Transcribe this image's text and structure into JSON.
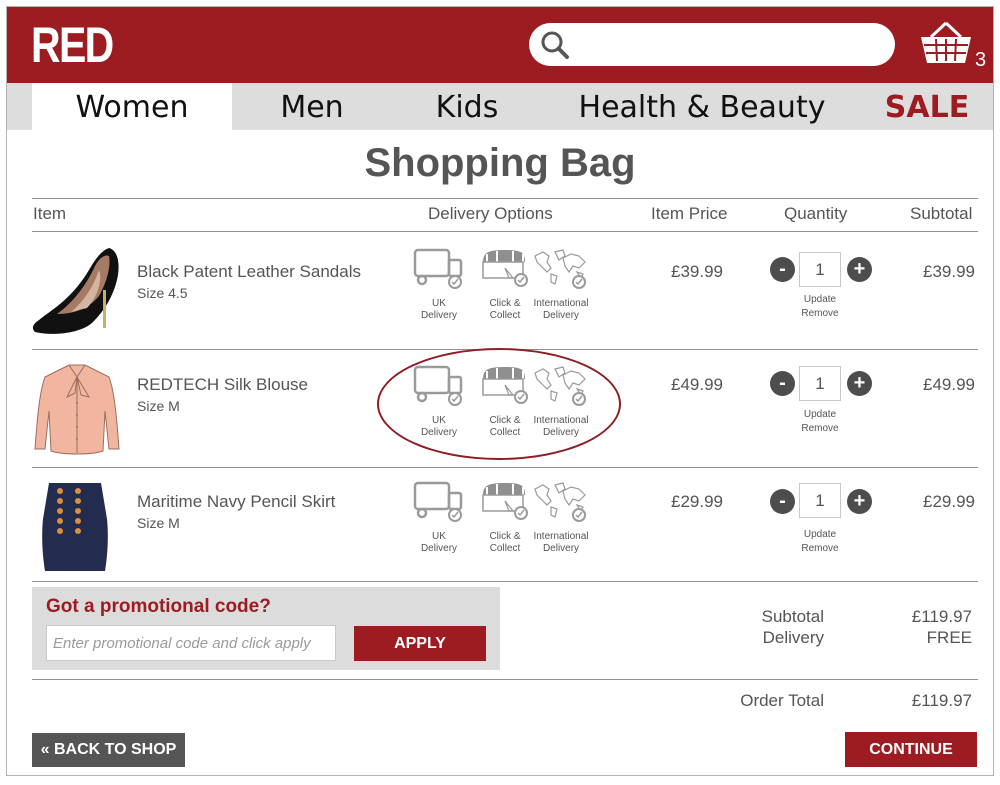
{
  "header": {
    "logo": "RED",
    "search": {
      "placeholder": "",
      "value": "",
      "icon": "search-icon"
    },
    "basket": {
      "icon": "basket-icon",
      "count": "3"
    },
    "brand_color": "#9c1c22"
  },
  "nav": {
    "items": [
      {
        "label": "Women",
        "active": true
      },
      {
        "label": "Men"
      },
      {
        "label": "Kids"
      },
      {
        "label": "Health & Beauty"
      },
      {
        "label": "SALE",
        "highlight": true
      }
    ]
  },
  "page_title": "Shopping Bag",
  "table": {
    "headers": {
      "item": "Item",
      "delivery": "Delivery Options",
      "price": "Item Price",
      "quantity": "Quantity",
      "subtotal": "Subtotal"
    },
    "delivery_options": [
      {
        "line1": "UK",
        "line2": "Delivery",
        "icon": "truck-icon"
      },
      {
        "line1": "Click &",
        "line2": "Collect",
        "icon": "store-icon"
      },
      {
        "line1": "International",
        "line2": "Delivery",
        "icon": "world-map-icon"
      }
    ],
    "rows": [
      {
        "name": "Black Patent Leather Sandals",
        "size": "Size 4.5",
        "image": "black-high-heel-shoe",
        "price": "£39.99",
        "quantity": "1",
        "subtotal": "£39.99",
        "update": "Update",
        "remove": "Remove"
      },
      {
        "name": "REDTECH Silk Blouse",
        "size": "Size M",
        "image": "pink-silk-blouse",
        "price": "£49.99",
        "quantity": "1",
        "subtotal": "£49.99",
        "update": "Update",
        "remove": "Remove",
        "delivery_highlighted": true
      },
      {
        "name": "Maritime Navy Pencil Skirt",
        "size": "Size M",
        "image": "navy-pencil-skirt",
        "price": "£29.99",
        "quantity": "1",
        "subtotal": "£29.99",
        "update": "Update",
        "remove": "Remove"
      }
    ],
    "qty_minus": "-",
    "qty_plus": "+"
  },
  "promo": {
    "title": "Got a promotional code?",
    "placeholder": "Enter promotional code and click apply",
    "value": "",
    "apply_label": "APPLY"
  },
  "summary": {
    "subtotal_label": "Subtotal",
    "subtotal_value": "£119.97",
    "delivery_label": "Delivery",
    "delivery_value": "FREE",
    "total_label": "Order Total",
    "total_value": "£119.97"
  },
  "actions": {
    "back_label": "« BACK TO SHOP",
    "continue_label": "CONTINUE"
  }
}
